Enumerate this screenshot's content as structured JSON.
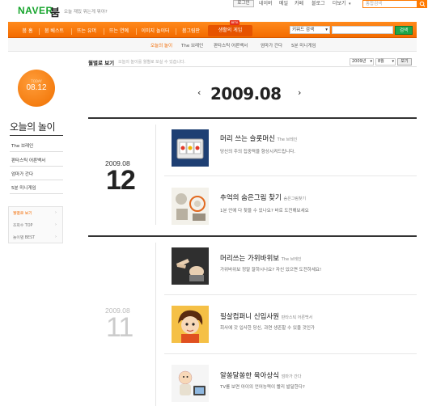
{
  "header": {
    "logo": "NAVER",
    "service": "붐",
    "tagline": "오늘 재밌 뭐는게 뭐야?",
    "top_links": [
      "로그인",
      "네이버",
      "메일",
      "카페",
      "블로그",
      "더보기"
    ],
    "search_placeholder": "통합검색"
  },
  "nav": {
    "items": [
      "붐 홈",
      "붐 베스트",
      "뜨는 유머",
      "뜨는 연예",
      "이미지 놀이터",
      "붐그림판",
      "생활의 게임"
    ],
    "active_index": 6,
    "badge": "BETA",
    "search_select": "키워드 검색",
    "search_button": "검색"
  },
  "subnav": {
    "items": [
      "오늘의 놀이",
      "The 브레인",
      "판타스틱 어른백서",
      "엄마가 간다",
      "5분 미니게임"
    ]
  },
  "sidebar": {
    "circle_label": "TODAY",
    "circle_date": "08.12",
    "title": "오늘의 놀이",
    "items": [
      "The 브레인",
      "판타스틱 어른백서",
      "엄마가 간다",
      "5분 미니게임"
    ],
    "box_items": [
      "월별로 보기",
      "조회수 TOP",
      "놀이별 BEST"
    ]
  },
  "content": {
    "title": "월별로 보기",
    "description": "오늘의 놀이를 월별로 보실 수 있습니다.",
    "year_select": "2009년",
    "month_select": "8월",
    "go_button": "보기",
    "month_heading": "2009.08",
    "days": [
      {
        "ym": "2009.08",
        "day": "12",
        "games": [
          {
            "title": "머리 쓰는 슬롯머신",
            "category": "The 브레인",
            "desc": "당신의 주의 집중력을 향상시켜드립니다."
          },
          {
            "title": "추억의 숨은그림 찾기",
            "category": "숨은그림찾기",
            "desc": "1분 안에 다 찾을 수 있나요? 바로 도전해보세요"
          }
        ]
      },
      {
        "ym": "2009.08",
        "day": "11",
        "games": [
          {
            "title": "머리쓰는 가위바위보",
            "category": "The 브레인",
            "desc": "가위바위보 정말 잘하시나요? 자신 있으면 도전하세요!"
          },
          {
            "title": "필살컴퍼니 신입사원",
            "category": "판타스틱 어른백서",
            "desc": "회사에 갓 입사한 당신, 과연 생존할 수 있을 것인가"
          },
          {
            "title": "알쏭달쏭한 육아상식",
            "category": "엄마가 간다",
            "desc": "TV를 보면 아이의 언어능력이 빨리 발달한다?"
          }
        ]
      }
    ]
  },
  "colors": {
    "accent": "#f36b00",
    "brand": "#17a52d"
  }
}
